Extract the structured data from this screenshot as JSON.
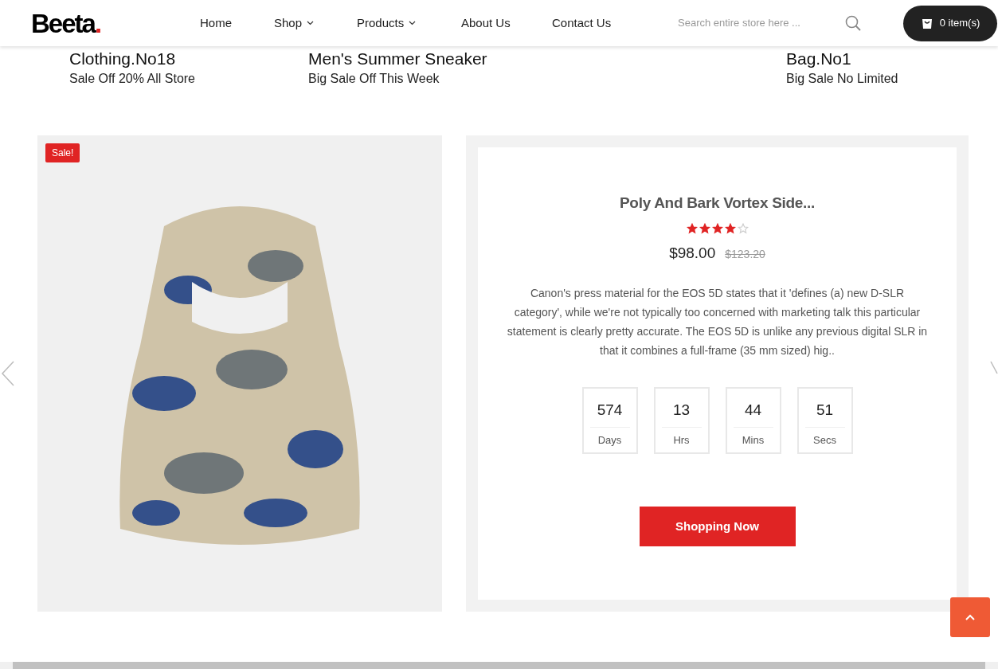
{
  "header": {
    "logo": "Beeta",
    "logo_dot": ".",
    "nav": [
      {
        "label": "Home",
        "dropdown": false
      },
      {
        "label": "Shop",
        "dropdown": true
      },
      {
        "label": "Products",
        "dropdown": true
      },
      {
        "label": "About Us",
        "dropdown": false
      },
      {
        "label": "Contact Us",
        "dropdown": false
      }
    ],
    "search": {
      "placeholder": "Search entire store here ..."
    },
    "cart": "0 item(s)"
  },
  "banners": [
    {
      "title": "Clothing.No18",
      "subtitle": "Sale Off 20% All Store"
    },
    {
      "title": "Men's Summer Sneaker",
      "subtitle": "Big Sale Off This Week"
    },
    {
      "title": "Bag.No1",
      "subtitle": "Big Sale No Limited"
    }
  ],
  "product": {
    "badge": "Sale!",
    "name": "Poly And Bark Vortex Side...",
    "stars": 4,
    "price": "$98.00",
    "old_price": "$123.20",
    "description": "Canon's press material for the EOS 5D states that it 'defines (a) new D-SLR category', while we're not typically too concerned with marketing talk this particular statement is clearly pretty accurate. The EOS 5D is unlike any previous digital SLR in that it combines a full-frame (35 mm sized) hig..",
    "countdown": [
      {
        "value": "574",
        "unit": "Days"
      },
      {
        "value": "13",
        "unit": "Hrs"
      },
      {
        "value": "44",
        "unit": "Mins"
      },
      {
        "value": "51",
        "unit": "Secs"
      }
    ],
    "button": "Shopping Now"
  }
}
